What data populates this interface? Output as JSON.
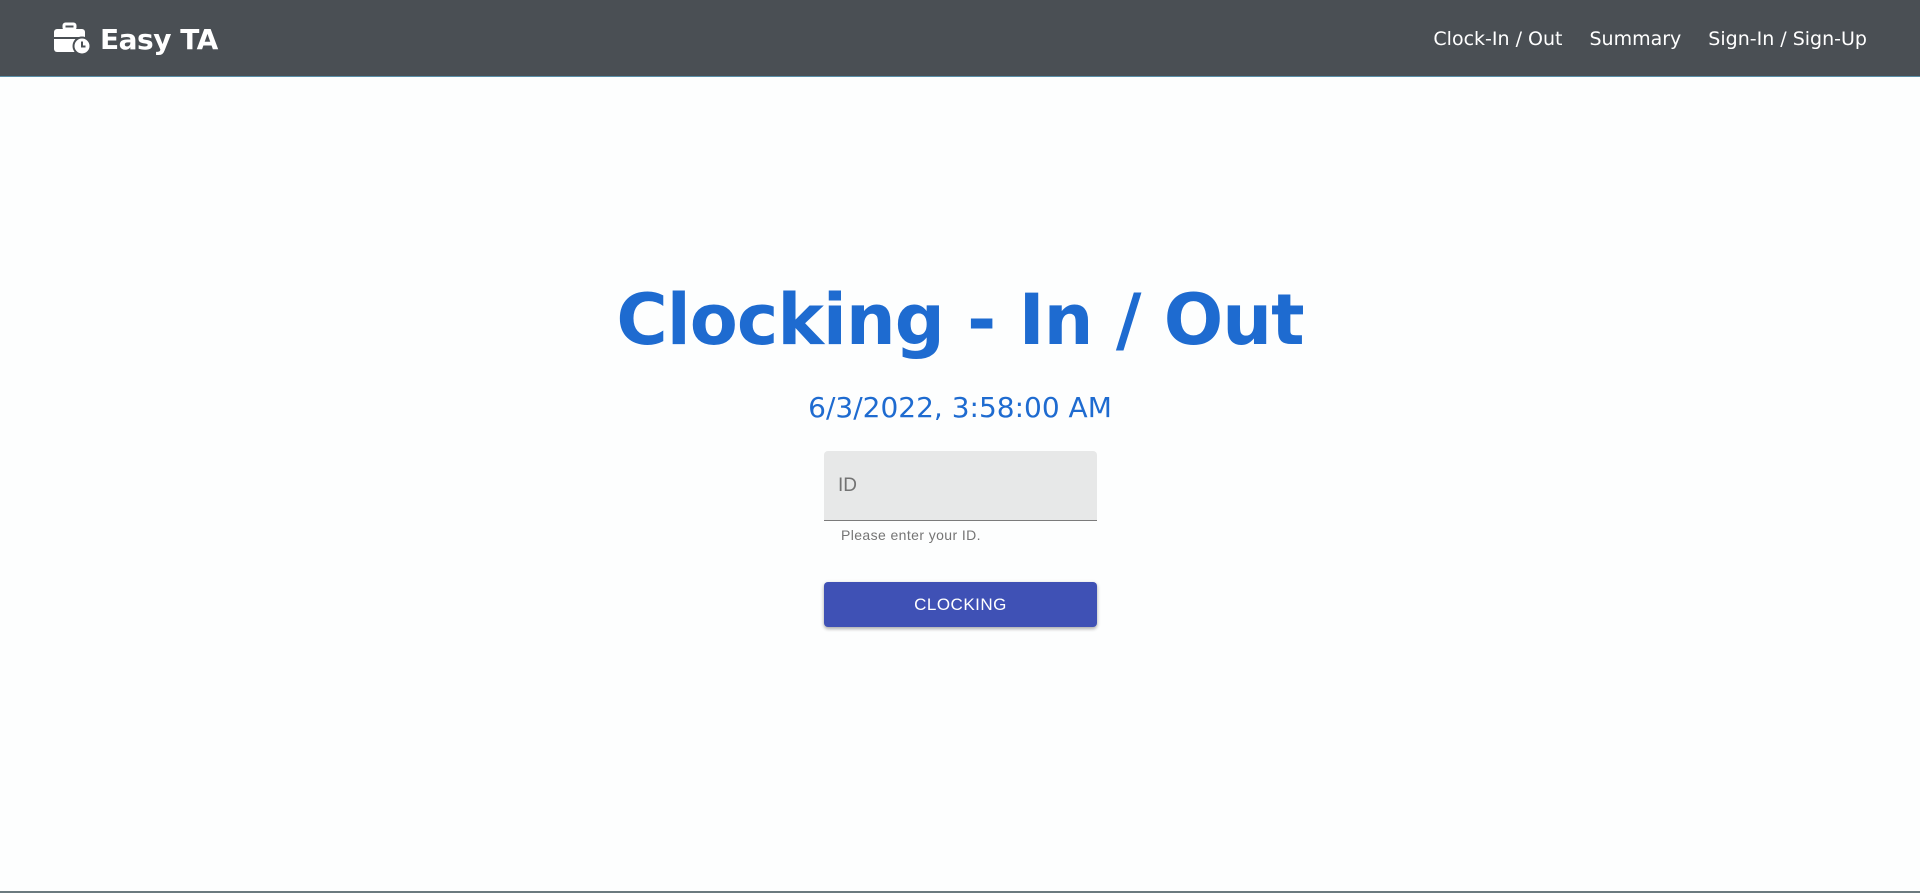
{
  "navbar": {
    "brand": "Easy TA",
    "brand_icon": "briefcase-clock-icon",
    "links": [
      "Clock-In / Out",
      "Summary",
      "Sign-In / Sign-Up"
    ]
  },
  "main": {
    "title": "Clocking - In / Out",
    "datetime": "6/3/2022, 3:58:00 AM",
    "id_field": {
      "placeholder": "ID",
      "value": "",
      "helper": "Please enter your ID."
    },
    "button_label": "CLOCKING"
  },
  "colors": {
    "navbar_bg": "#4a4f54",
    "title": "#1e6bd0",
    "button": "#3f51b5"
  }
}
